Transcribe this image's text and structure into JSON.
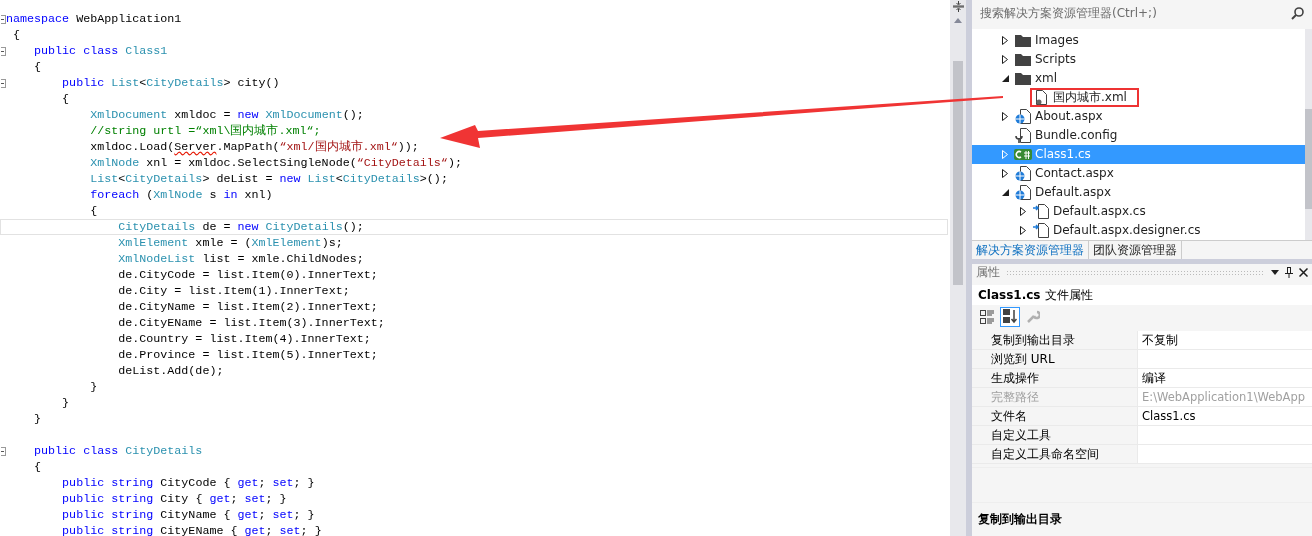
{
  "code_editor": {
    "lines": [
      {
        "foldable": true,
        "current": false,
        "tokens": [
          {
            "kind": "kw",
            "text": "namespace"
          },
          {
            "kind": "plain",
            "text": " WebApplication1"
          }
        ]
      },
      {
        "foldable": false,
        "current": false,
        "tokens": [
          {
            "kind": "plain",
            "text": " {"
          }
        ]
      },
      {
        "foldable": true,
        "current": false,
        "tokens": [
          {
            "kind": "kw",
            "text": "    public class"
          },
          {
            "kind": "type",
            "text": " Class1"
          }
        ]
      },
      {
        "foldable": false,
        "current": false,
        "tokens": [
          {
            "kind": "plain",
            "text": "    {"
          }
        ]
      },
      {
        "foldable": true,
        "current": false,
        "tokens": [
          {
            "kind": "kw",
            "text": "        public"
          },
          {
            "kind": "type",
            "text": " List"
          },
          {
            "kind": "plain",
            "text": "<"
          },
          {
            "kind": "type",
            "text": "CityDetails"
          },
          {
            "kind": "plain",
            "text": "> city()"
          }
        ]
      },
      {
        "foldable": false,
        "current": false,
        "tokens": [
          {
            "kind": "plain",
            "text": "        {"
          }
        ]
      },
      {
        "foldable": false,
        "current": false,
        "tokens": [
          {
            "kind": "type",
            "text": "            XmlDocument"
          },
          {
            "kind": "plain",
            "text": " xmldoc = "
          },
          {
            "kind": "kw",
            "text": "new"
          },
          {
            "kind": "type",
            "text": " XmlDocument"
          },
          {
            "kind": "plain",
            "text": "();"
          }
        ]
      },
      {
        "foldable": false,
        "current": false,
        "tokens": [
          {
            "kind": "comment",
            "text": "            //string urtl =“xml\\国内城市.xml“;"
          }
        ]
      },
      {
        "foldable": false,
        "current": false,
        "tokens": [
          {
            "kind": "plain",
            "text": "            xmldoc.Load("
          },
          {
            "kind": "error",
            "text": "Server"
          },
          {
            "kind": "plain",
            "text": ".MapPath("
          },
          {
            "kind": "str",
            "text": "“xml/国内城市.xml“"
          },
          {
            "kind": "plain",
            "text": "));"
          }
        ]
      },
      {
        "foldable": false,
        "current": false,
        "tokens": [
          {
            "kind": "type",
            "text": "            XmlNode"
          },
          {
            "kind": "plain",
            "text": " xnl = xmldoc.SelectSingleNode("
          },
          {
            "kind": "str",
            "text": "“CityDetails“"
          },
          {
            "kind": "plain",
            "text": ");"
          }
        ]
      },
      {
        "foldable": false,
        "current": false,
        "tokens": [
          {
            "kind": "type",
            "text": "            List"
          },
          {
            "kind": "plain",
            "text": "<"
          },
          {
            "kind": "type",
            "text": "CityDetails"
          },
          {
            "kind": "plain",
            "text": "> deList = "
          },
          {
            "kind": "kw",
            "text": "new"
          },
          {
            "kind": "type",
            "text": " List"
          },
          {
            "kind": "plain",
            "text": "<"
          },
          {
            "kind": "type",
            "text": "CityDetails"
          },
          {
            "kind": "plain",
            "text": ">();"
          }
        ]
      },
      {
        "foldable": false,
        "current": false,
        "tokens": [
          {
            "kind": "kw",
            "text": "            foreach"
          },
          {
            "kind": "plain",
            "text": " ("
          },
          {
            "kind": "type",
            "text": "XmlNode"
          },
          {
            "kind": "plain",
            "text": " s "
          },
          {
            "kind": "kw",
            "text": "in"
          },
          {
            "kind": "plain",
            "text": " xnl)"
          }
        ]
      },
      {
        "foldable": false,
        "current": false,
        "tokens": [
          {
            "kind": "plain",
            "text": "            {"
          }
        ]
      },
      {
        "foldable": false,
        "current": true,
        "tokens": [
          {
            "kind": "type",
            "text": "                CityDetails"
          },
          {
            "kind": "plain",
            "text": " de = "
          },
          {
            "kind": "kw",
            "text": "new"
          },
          {
            "kind": "type",
            "text": " CityDetails"
          },
          {
            "kind": "plain",
            "text": "();"
          }
        ]
      },
      {
        "foldable": false,
        "current": false,
        "tokens": [
          {
            "kind": "type",
            "text": "                XmlElement"
          },
          {
            "kind": "plain",
            "text": " xmle = ("
          },
          {
            "kind": "type",
            "text": "XmlElement"
          },
          {
            "kind": "plain",
            "text": ")s;"
          }
        ]
      },
      {
        "foldable": false,
        "current": false,
        "tokens": [
          {
            "kind": "type",
            "text": "                XmlNodeList"
          },
          {
            "kind": "plain",
            "text": " list = xmle.ChildNodes;"
          }
        ]
      },
      {
        "foldable": false,
        "current": false,
        "tokens": [
          {
            "kind": "plain",
            "text": "                de.CityCode = list.Item(0).InnerText;"
          }
        ]
      },
      {
        "foldable": false,
        "current": false,
        "tokens": [
          {
            "kind": "plain",
            "text": "                de.City = list.Item(1).InnerText;"
          }
        ]
      },
      {
        "foldable": false,
        "current": false,
        "tokens": [
          {
            "kind": "plain",
            "text": "                de.CityName = list.Item(2).InnerText;"
          }
        ]
      },
      {
        "foldable": false,
        "current": false,
        "tokens": [
          {
            "kind": "plain",
            "text": "                de.CityEName = list.Item(3).InnerText;"
          }
        ]
      },
      {
        "foldable": false,
        "current": false,
        "tokens": [
          {
            "kind": "plain",
            "text": "                de.Country = list.Item(4).InnerText;"
          }
        ]
      },
      {
        "foldable": false,
        "current": false,
        "tokens": [
          {
            "kind": "plain",
            "text": "                de.Province = list.Item(5).InnerText;"
          }
        ]
      },
      {
        "foldable": false,
        "current": false,
        "tokens": [
          {
            "kind": "plain",
            "text": "                deList.Add(de);"
          }
        ]
      },
      {
        "foldable": false,
        "current": false,
        "tokens": [
          {
            "kind": "plain",
            "text": "            }"
          }
        ]
      },
      {
        "foldable": false,
        "current": false,
        "tokens": [
          {
            "kind": "plain",
            "text": "        }"
          }
        ]
      },
      {
        "foldable": false,
        "current": false,
        "tokens": [
          {
            "kind": "plain",
            "text": "    }"
          }
        ]
      },
      {
        "foldable": false,
        "current": false
      },
      {
        "foldable": true,
        "current": false,
        "tokens": [
          {
            "kind": "kw",
            "text": "    public class"
          },
          {
            "kind": "type",
            "text": " CityDetails"
          }
        ]
      },
      {
        "foldable": false,
        "current": false,
        "tokens": [
          {
            "kind": "plain",
            "text": "    {"
          }
        ]
      },
      {
        "foldable": false,
        "current": false,
        "tokens": [
          {
            "kind": "kw",
            "text": "        public string"
          },
          {
            "kind": "plain",
            "text": " CityCode { "
          },
          {
            "kind": "kw",
            "text": "get"
          },
          {
            "kind": "plain",
            "text": "; "
          },
          {
            "kind": "kw",
            "text": "set"
          },
          {
            "kind": "plain",
            "text": "; }"
          }
        ]
      },
      {
        "foldable": false,
        "current": false,
        "tokens": [
          {
            "kind": "kw",
            "text": "        public string"
          },
          {
            "kind": "plain",
            "text": " City { "
          },
          {
            "kind": "kw",
            "text": "get"
          },
          {
            "kind": "plain",
            "text": "; "
          },
          {
            "kind": "kw",
            "text": "set"
          },
          {
            "kind": "plain",
            "text": "; }"
          }
        ]
      },
      {
        "foldable": false,
        "current": false,
        "tokens": [
          {
            "kind": "kw",
            "text": "        public string"
          },
          {
            "kind": "plain",
            "text": " CityName { "
          },
          {
            "kind": "kw",
            "text": "get"
          },
          {
            "kind": "plain",
            "text": "; "
          },
          {
            "kind": "kw",
            "text": "set"
          },
          {
            "kind": "plain",
            "text": "; }"
          }
        ]
      },
      {
        "foldable": false,
        "current": false,
        "tokens": [
          {
            "kind": "kw",
            "text": "        public string"
          },
          {
            "kind": "plain",
            "text": " CityEName { "
          },
          {
            "kind": "kw",
            "text": "get"
          },
          {
            "kind": "plain",
            "text": "; "
          },
          {
            "kind": "kw",
            "text": "set"
          },
          {
            "kind": "plain",
            "text": "; }"
          }
        ]
      }
    ]
  },
  "solution_explorer": {
    "search": {
      "placeholder": "搜索解决方案资源管理器(Ctrl+;)"
    },
    "tree": [
      {
        "label": "Images",
        "kind": "folder",
        "expanded": false,
        "selected": false,
        "highlighted": false
      },
      {
        "label": "Scripts",
        "kind": "folder",
        "expanded": false,
        "selected": false,
        "highlighted": false
      },
      {
        "label": "xml",
        "kind": "folder",
        "expanded": true,
        "selected": false,
        "highlighted": false,
        "children": [
          {
            "label": "国内城市.xml",
            "kind": "file",
            "selected": false,
            "highlighted": true
          }
        ]
      },
      {
        "label": "About.aspx",
        "kind": "web",
        "expanded": false,
        "selected": false,
        "highlighted": false
      },
      {
        "label": "Bundle.config",
        "kind": "config",
        "selected": false,
        "highlighted": false
      },
      {
        "label": "Class1.cs",
        "kind": "csharp",
        "expanded": false,
        "selected": true,
        "highlighted": false
      },
      {
        "label": "Contact.aspx",
        "kind": "web",
        "expanded": false,
        "selected": false,
        "highlighted": false
      },
      {
        "label": "Default.aspx",
        "kind": "web",
        "expanded": true,
        "selected": false,
        "highlighted": false,
        "children": [
          {
            "label": "Default.aspx.cs",
            "kind": "code",
            "expanded": false,
            "selected": false,
            "highlighted": false
          },
          {
            "label": "Default.aspx.designer.cs",
            "kind": "code",
            "expanded": false,
            "selected": false,
            "highlighted": false
          }
        ]
      }
    ],
    "tabs": [
      {
        "label": "解决方案资源管理器",
        "selected": true
      },
      {
        "label": "团队资源管理器",
        "selected": false
      }
    ]
  },
  "properties": {
    "title": "属性",
    "object_name": "Class1.cs",
    "object_type": "文件属性",
    "toolbar": [
      {
        "kind": "categorized",
        "selected": false,
        "disabled": false
      },
      {
        "kind": "alphabetical",
        "selected": true,
        "disabled": false
      },
      {
        "kind": "property-pages",
        "selected": false,
        "disabled": true
      }
    ],
    "rows": [
      {
        "name": "复制到输出目录",
        "value": "不复制",
        "disabled": false
      },
      {
        "name": "浏览到 URL",
        "disabled": false
      },
      {
        "name": "生成操作",
        "value": "编译",
        "disabled": false
      },
      {
        "name": "完整路径",
        "value": "E:\\WebApplication1\\WebApp",
        "disabled": true
      },
      {
        "name": "文件名",
        "value": "Class1.cs",
        "disabled": false
      },
      {
        "name": "自定义工具",
        "disabled": false
      },
      {
        "name": "自定义工具命名空间",
        "disabled": false
      }
    ],
    "description_title": "复制到输出目录"
  }
}
